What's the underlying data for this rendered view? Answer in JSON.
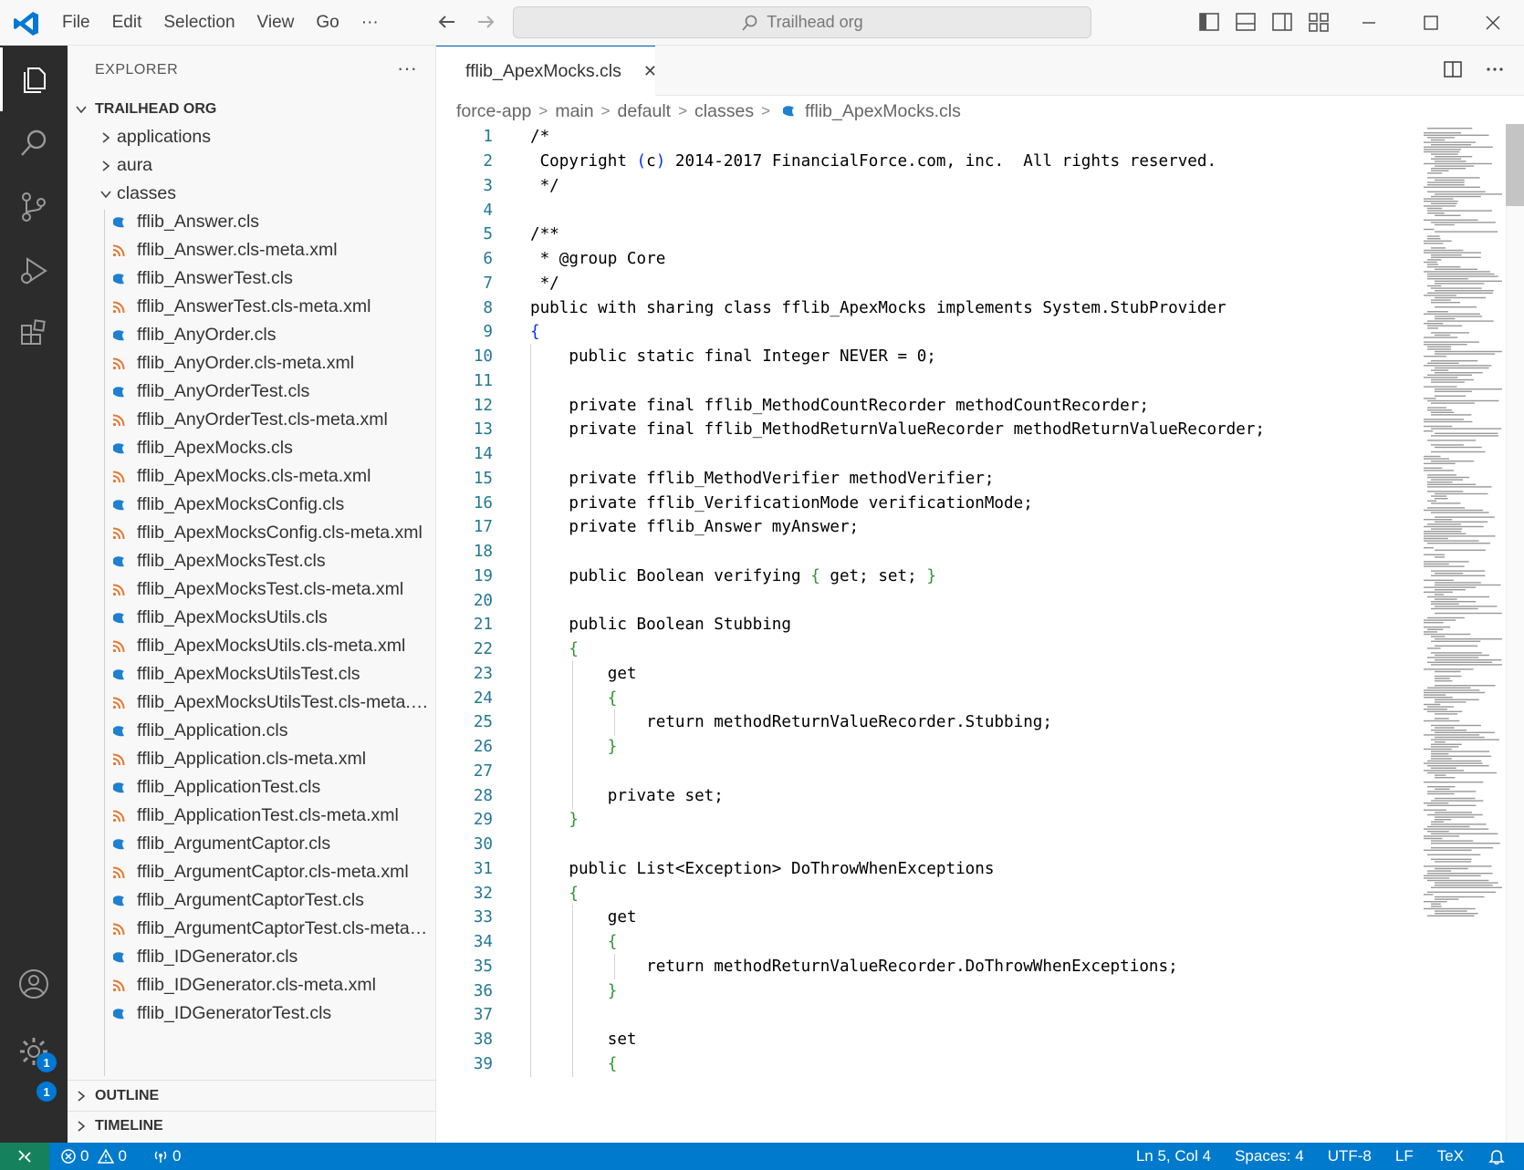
{
  "menu": [
    "File",
    "Edit",
    "Selection",
    "View",
    "Go",
    "···"
  ],
  "command_center": {
    "text": "Trailhead org"
  },
  "explorer": {
    "title": "EXPLORER",
    "more": "···",
    "root": "TRAILHEAD ORG",
    "folders": [
      "applications",
      "aura",
      "classes"
    ],
    "files": [
      {
        "name": "fflib_Answer.cls",
        "type": "cls"
      },
      {
        "name": "fflib_Answer.cls-meta.xml",
        "type": "xml"
      },
      {
        "name": "fflib_AnswerTest.cls",
        "type": "cls"
      },
      {
        "name": "fflib_AnswerTest.cls-meta.xml",
        "type": "xml"
      },
      {
        "name": "fflib_AnyOrder.cls",
        "type": "cls"
      },
      {
        "name": "fflib_AnyOrder.cls-meta.xml",
        "type": "xml"
      },
      {
        "name": "fflib_AnyOrderTest.cls",
        "type": "cls"
      },
      {
        "name": "fflib_AnyOrderTest.cls-meta.xml",
        "type": "xml"
      },
      {
        "name": "fflib_ApexMocks.cls",
        "type": "cls"
      },
      {
        "name": "fflib_ApexMocks.cls-meta.xml",
        "type": "xml"
      },
      {
        "name": "fflib_ApexMocksConfig.cls",
        "type": "cls"
      },
      {
        "name": "fflib_ApexMocksConfig.cls-meta.xml",
        "type": "xml"
      },
      {
        "name": "fflib_ApexMocksTest.cls",
        "type": "cls"
      },
      {
        "name": "fflib_ApexMocksTest.cls-meta.xml",
        "type": "xml"
      },
      {
        "name": "fflib_ApexMocksUtils.cls",
        "type": "cls"
      },
      {
        "name": "fflib_ApexMocksUtils.cls-meta.xml",
        "type": "xml"
      },
      {
        "name": "fflib_ApexMocksUtilsTest.cls",
        "type": "cls"
      },
      {
        "name": "fflib_ApexMocksUtilsTest.cls-meta.xml",
        "type": "xml"
      },
      {
        "name": "fflib_Application.cls",
        "type": "cls"
      },
      {
        "name": "fflib_Application.cls-meta.xml",
        "type": "xml"
      },
      {
        "name": "fflib_ApplicationTest.cls",
        "type": "cls"
      },
      {
        "name": "fflib_ApplicationTest.cls-meta.xml",
        "type": "xml"
      },
      {
        "name": "fflib_ArgumentCaptor.cls",
        "type": "cls"
      },
      {
        "name": "fflib_ArgumentCaptor.cls-meta.xml",
        "type": "xml"
      },
      {
        "name": "fflib_ArgumentCaptorTest.cls",
        "type": "cls"
      },
      {
        "name": "fflib_ArgumentCaptorTest.cls-meta.x...",
        "type": "xml"
      },
      {
        "name": "fflib_IDGenerator.cls",
        "type": "cls"
      },
      {
        "name": "fflib_IDGenerator.cls-meta.xml",
        "type": "xml"
      },
      {
        "name": "fflib_IDGeneratorTest.cls",
        "type": "cls"
      }
    ],
    "outline": "OUTLINE",
    "timeline": "TIMELINE"
  },
  "editor": {
    "tab_label": "fflib_ApexMocks.cls",
    "breadcrumb": [
      "force-app",
      "main",
      "default",
      "classes",
      "fflib_ApexMocks.cls"
    ],
    "lines": [
      "/*",
      " Copyright (c) 2014-2017 FinancialForce.com, inc.  All rights reserved.",
      " */",
      "",
      "/**",
      " * @group Core",
      " */",
      "public with sharing class fflib_ApexMocks implements System.StubProvider",
      "{",
      "    public static final Integer NEVER = 0;",
      "",
      "    private final fflib_MethodCountRecorder methodCountRecorder;",
      "    private final fflib_MethodReturnValueRecorder methodReturnValueRecorder;",
      "",
      "    private fflib_MethodVerifier methodVerifier;",
      "    private fflib_VerificationMode verificationMode;",
      "    private fflib_Answer myAnswer;",
      "",
      "    public Boolean verifying { get; set; }",
      "",
      "    public Boolean Stubbing",
      "    {",
      "        get",
      "        {",
      "            return methodReturnValueRecorder.Stubbing;",
      "        }",
      "",
      "        private set;",
      "    }",
      "",
      "    public List<Exception> DoThrowWhenExceptions",
      "    {",
      "        get",
      "        {",
      "            return methodReturnValueRecorder.DoThrowWhenExceptions;",
      "        }",
      "",
      "        set",
      "        {"
    ]
  },
  "activity_badges": {
    "accounts": "1",
    "manage": "1"
  },
  "status": {
    "errors": "0",
    "warnings": "0",
    "ports": "0",
    "position": "Ln 5, Col 4",
    "spaces": "Spaces: 4",
    "encoding": "UTF-8",
    "eol": "LF",
    "language": "TeX"
  },
  "colors": {
    "accent": "#007acc",
    "activity_bg": "#2c2c2c",
    "cls_icon": "#1f7fd1",
    "xml_icon": "#e37933",
    "line_number": "#237893"
  }
}
